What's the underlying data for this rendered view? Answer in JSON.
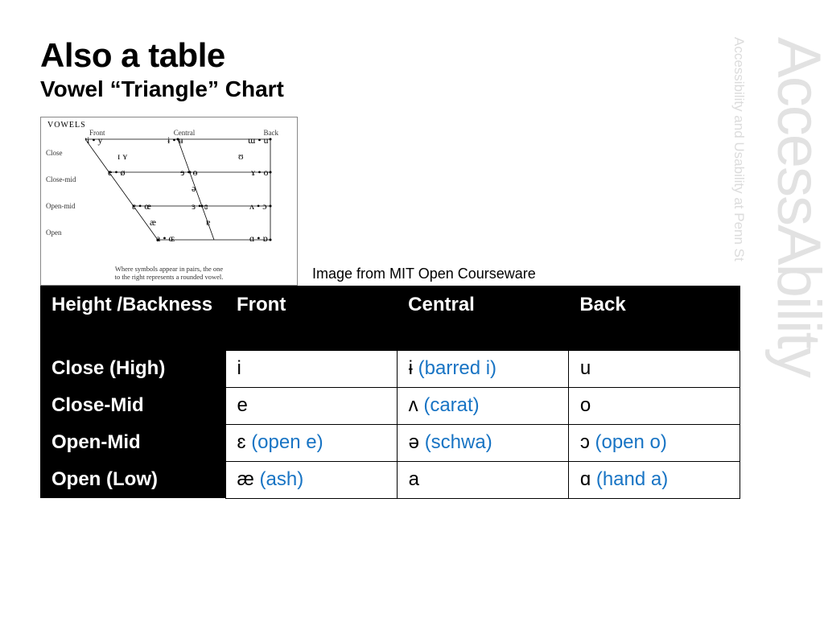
{
  "title": "Also a table",
  "subtitle": "Vowel  “Triangle” Chart",
  "diagram": {
    "heading": "VOWELS",
    "cols": [
      "Front",
      "Central",
      "Back"
    ],
    "rows": [
      "Close",
      "Close-mid",
      "Open-mid",
      "Open"
    ],
    "caption1": "Where symbols appear in pairs, the one",
    "caption2": "to the right represents a rounded vowel."
  },
  "credit": "Image from MIT Open Courseware",
  "table": {
    "headers": [
      "Height /Backness",
      "Front",
      "Central",
      "Back"
    ],
    "rows": [
      {
        "label": "Close (High)",
        "cells": [
          {
            "sym": "i",
            "paren": ""
          },
          {
            "sym": "ɨ",
            "paren": "(barred i)"
          },
          {
            "sym": "u",
            "paren": ""
          }
        ]
      },
      {
        "label": "Close-Mid",
        "cells": [
          {
            "sym": "e",
            "paren": ""
          },
          {
            "sym": "ʌ",
            "paren": "(carat)"
          },
          {
            "sym": "o",
            "paren": ""
          }
        ]
      },
      {
        "label": "Open-Mid",
        "cells": [
          {
            "sym": "ɛ",
            "paren": "(open e)"
          },
          {
            "sym": "ə",
            "paren": "(schwa)"
          },
          {
            "sym": "ɔ",
            "paren": "(open o)"
          }
        ]
      },
      {
        "label": "Open (Low)",
        "cells": [
          {
            "sym": "æ",
            "paren": "(ash)"
          },
          {
            "sym": "a",
            "paren": ""
          },
          {
            "sym": "ɑ",
            "paren": "(hand a)"
          }
        ]
      }
    ]
  },
  "watermark": {
    "big_a": "Access",
    "big_b": "Ability",
    "small": "Accessibility and Usability at Penn St"
  },
  "chart_data": {
    "type": "table",
    "title": "Vowel “Triangle” Chart",
    "row_labels": [
      "Close (High)",
      "Close-Mid",
      "Open-Mid",
      "Open (Low)"
    ],
    "col_labels": [
      "Front",
      "Central",
      "Back"
    ],
    "cells": [
      [
        "i",
        "ɨ (barred i)",
        "u"
      ],
      [
        "e",
        "ʌ (carat)",
        "o"
      ],
      [
        "ɛ (open e)",
        "ə (schwa)",
        "ɔ (open o)"
      ],
      [
        "æ (ash)",
        "a",
        "ɑ (hand a)"
      ]
    ],
    "diagram_vowels": {
      "Close": {
        "Front": "i • y",
        "Central": "ɨ • ʉ",
        "Back": "ɯ • u"
      },
      "Near-close": {
        "Front": "ɪ  ʏ",
        "Back": "ʊ"
      },
      "Close-mid": {
        "Front": "e • ø",
        "Central": "ɘ • ɵ",
        "Back": "ɤ • o"
      },
      "Mid": {
        "Central": "ə"
      },
      "Open-mid": {
        "Front": "ɛ • œ",
        "Central": "ɜ • ɞ",
        "Back": "ʌ • ɔ"
      },
      "Near-open": {
        "Front": "æ",
        "Central": "ɐ"
      },
      "Open": {
        "Front": "a • ɶ",
        "Back": "ɑ • ɒ"
      }
    }
  }
}
